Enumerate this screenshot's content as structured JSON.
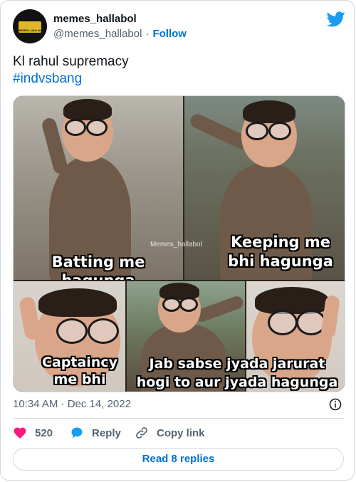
{
  "author": {
    "display_name": "memes_hallabol",
    "handle": "@memes_hallabol",
    "separator": "·",
    "follow_label": "Follow",
    "avatar_text": "MEMES_HALLABOL"
  },
  "tweet": {
    "text": "Kl rahul supremacy",
    "hashtag": "#indvsbang"
  },
  "media": {
    "watermark": "Memes_hallabol",
    "captions": {
      "panel1": "Batting me hagunga",
      "panel2": "Keeping me bhi hagunga",
      "panel3": "Captaincy me bhi",
      "panel4": "Jab sabse jyada jarurat hogi to aur jyada hagunga"
    }
  },
  "meta": {
    "timestamp": "10:34 AM · Dec 14, 2022"
  },
  "actions": {
    "like_count": "520",
    "reply_label": "Reply",
    "copy_label": "Copy link"
  },
  "replies_button": "Read 8 replies",
  "colors": {
    "accent": "#006fd6",
    "like": "#f91880",
    "reply_icon": "#1d9bf0",
    "twitter_bird": "#1d9bf0",
    "muted": "#536471"
  }
}
